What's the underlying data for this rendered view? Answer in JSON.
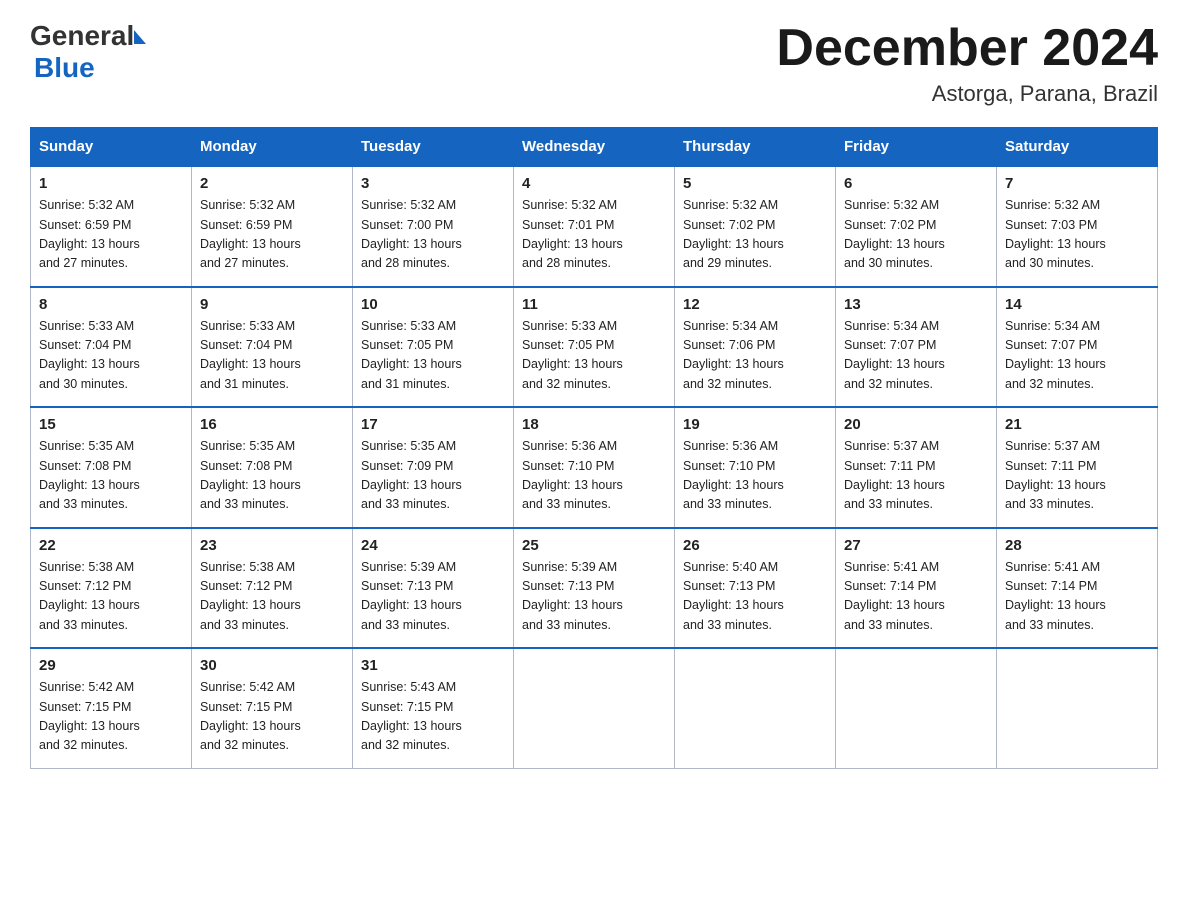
{
  "header": {
    "logo_general": "General",
    "logo_blue": "Blue",
    "month_title": "December 2024",
    "location": "Astorga, Parana, Brazil"
  },
  "days_of_week": [
    "Sunday",
    "Monday",
    "Tuesday",
    "Wednesday",
    "Thursday",
    "Friday",
    "Saturday"
  ],
  "weeks": [
    [
      {
        "day": "1",
        "sunrise": "5:32 AM",
        "sunset": "6:59 PM",
        "daylight": "13 hours and 27 minutes."
      },
      {
        "day": "2",
        "sunrise": "5:32 AM",
        "sunset": "6:59 PM",
        "daylight": "13 hours and 27 minutes."
      },
      {
        "day": "3",
        "sunrise": "5:32 AM",
        "sunset": "7:00 PM",
        "daylight": "13 hours and 28 minutes."
      },
      {
        "day": "4",
        "sunrise": "5:32 AM",
        "sunset": "7:01 PM",
        "daylight": "13 hours and 28 minutes."
      },
      {
        "day": "5",
        "sunrise": "5:32 AM",
        "sunset": "7:02 PM",
        "daylight": "13 hours and 29 minutes."
      },
      {
        "day": "6",
        "sunrise": "5:32 AM",
        "sunset": "7:02 PM",
        "daylight": "13 hours and 30 minutes."
      },
      {
        "day": "7",
        "sunrise": "5:32 AM",
        "sunset": "7:03 PM",
        "daylight": "13 hours and 30 minutes."
      }
    ],
    [
      {
        "day": "8",
        "sunrise": "5:33 AM",
        "sunset": "7:04 PM",
        "daylight": "13 hours and 30 minutes."
      },
      {
        "day": "9",
        "sunrise": "5:33 AM",
        "sunset": "7:04 PM",
        "daylight": "13 hours and 31 minutes."
      },
      {
        "day": "10",
        "sunrise": "5:33 AM",
        "sunset": "7:05 PM",
        "daylight": "13 hours and 31 minutes."
      },
      {
        "day": "11",
        "sunrise": "5:33 AM",
        "sunset": "7:05 PM",
        "daylight": "13 hours and 32 minutes."
      },
      {
        "day": "12",
        "sunrise": "5:34 AM",
        "sunset": "7:06 PM",
        "daylight": "13 hours and 32 minutes."
      },
      {
        "day": "13",
        "sunrise": "5:34 AM",
        "sunset": "7:07 PM",
        "daylight": "13 hours and 32 minutes."
      },
      {
        "day": "14",
        "sunrise": "5:34 AM",
        "sunset": "7:07 PM",
        "daylight": "13 hours and 32 minutes."
      }
    ],
    [
      {
        "day": "15",
        "sunrise": "5:35 AM",
        "sunset": "7:08 PM",
        "daylight": "13 hours and 33 minutes."
      },
      {
        "day": "16",
        "sunrise": "5:35 AM",
        "sunset": "7:08 PM",
        "daylight": "13 hours and 33 minutes."
      },
      {
        "day": "17",
        "sunrise": "5:35 AM",
        "sunset": "7:09 PM",
        "daylight": "13 hours and 33 minutes."
      },
      {
        "day": "18",
        "sunrise": "5:36 AM",
        "sunset": "7:10 PM",
        "daylight": "13 hours and 33 minutes."
      },
      {
        "day": "19",
        "sunrise": "5:36 AM",
        "sunset": "7:10 PM",
        "daylight": "13 hours and 33 minutes."
      },
      {
        "day": "20",
        "sunrise": "5:37 AM",
        "sunset": "7:11 PM",
        "daylight": "13 hours and 33 minutes."
      },
      {
        "day": "21",
        "sunrise": "5:37 AM",
        "sunset": "7:11 PM",
        "daylight": "13 hours and 33 minutes."
      }
    ],
    [
      {
        "day": "22",
        "sunrise": "5:38 AM",
        "sunset": "7:12 PM",
        "daylight": "13 hours and 33 minutes."
      },
      {
        "day": "23",
        "sunrise": "5:38 AM",
        "sunset": "7:12 PM",
        "daylight": "13 hours and 33 minutes."
      },
      {
        "day": "24",
        "sunrise": "5:39 AM",
        "sunset": "7:13 PM",
        "daylight": "13 hours and 33 minutes."
      },
      {
        "day": "25",
        "sunrise": "5:39 AM",
        "sunset": "7:13 PM",
        "daylight": "13 hours and 33 minutes."
      },
      {
        "day": "26",
        "sunrise": "5:40 AM",
        "sunset": "7:13 PM",
        "daylight": "13 hours and 33 minutes."
      },
      {
        "day": "27",
        "sunrise": "5:41 AM",
        "sunset": "7:14 PM",
        "daylight": "13 hours and 33 minutes."
      },
      {
        "day": "28",
        "sunrise": "5:41 AM",
        "sunset": "7:14 PM",
        "daylight": "13 hours and 33 minutes."
      }
    ],
    [
      {
        "day": "29",
        "sunrise": "5:42 AM",
        "sunset": "7:15 PM",
        "daylight": "13 hours and 32 minutes."
      },
      {
        "day": "30",
        "sunrise": "5:42 AM",
        "sunset": "7:15 PM",
        "daylight": "13 hours and 32 minutes."
      },
      {
        "day": "31",
        "sunrise": "5:43 AM",
        "sunset": "7:15 PM",
        "daylight": "13 hours and 32 minutes."
      },
      null,
      null,
      null,
      null
    ]
  ],
  "labels": {
    "sunrise": "Sunrise:",
    "sunset": "Sunset:",
    "daylight": "Daylight:"
  }
}
